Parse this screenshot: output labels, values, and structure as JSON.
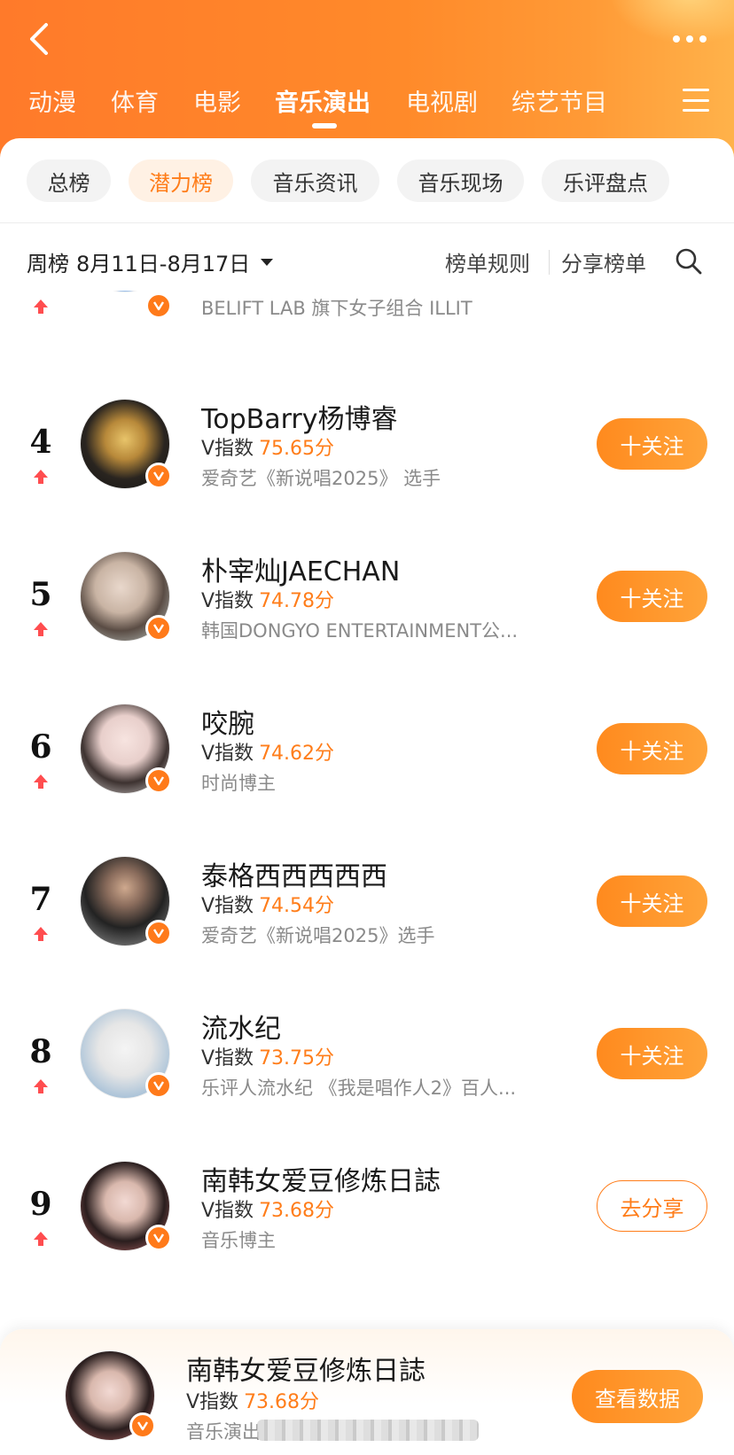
{
  "header": {
    "categories": [
      "动漫",
      "体育",
      "电影",
      "音乐演出",
      "电视剧",
      "综艺节目"
    ],
    "active_category": "音乐演出"
  },
  "sub_tabs": [
    "总榜",
    "潜力榜",
    "音乐资讯",
    "音乐现场",
    "乐评盘点"
  ],
  "active_sub_tab": "潜力榜",
  "period": {
    "type": "周榜",
    "range": "8月11日-8月17日"
  },
  "actions": {
    "rules": "榜单规则",
    "share": "分享榜单"
  },
  "score_label": "V指数",
  "partial_top_item": {
    "desc": "BELIFT LAB 旗下女子组合 ILLIT"
  },
  "items": [
    {
      "rank": "4",
      "name": "TopBarry杨博睿",
      "score": "75.65分",
      "desc": "爱奇艺《新说唱2025》 选手",
      "action": "十关注"
    },
    {
      "rank": "5",
      "name": "朴宰灿JAECHAN",
      "score": "74.78分",
      "desc": "韩国DONGYO ENTERTAINMENT公...",
      "action": "十关注"
    },
    {
      "rank": "6",
      "name": "咬腕",
      "score": "74.62分",
      "desc": "时尚博主",
      "action": "十关注"
    },
    {
      "rank": "7",
      "name": "泰格西西西西西",
      "score": "74.54分",
      "desc": "爱奇艺《新说唱2025》选手",
      "action": "十关注"
    },
    {
      "rank": "8",
      "name": "流水纪",
      "score": "73.75分",
      "desc": "乐评人流水纪 《我是唱作人2》百人...",
      "action": "十关注"
    },
    {
      "rank": "9",
      "name": "南韩女爱豆修炼日誌",
      "score": "73.68分",
      "desc": "音乐博主",
      "action": "去分享"
    }
  ],
  "bottom_card": {
    "name": "南韩女爱豆修炼日誌",
    "score": "73.68分",
    "desc": "音乐演出",
    "button": "查看数据"
  },
  "colors": {
    "accent": "#ff7d1a",
    "header_start": "#ff7a2a",
    "header_end": "#ffb24a",
    "rank_up": "#ff4d4f",
    "verified_badge": "#ff7a1a"
  },
  "icons": {
    "back": "chevron-left-icon",
    "more": "more-dots-icon",
    "menu": "hamburger-menu-icon",
    "search": "search-icon",
    "dropdown": "caret-down-icon",
    "rank_trend": "arrow-up-icon",
    "verified": "verified-v-badge-icon"
  }
}
